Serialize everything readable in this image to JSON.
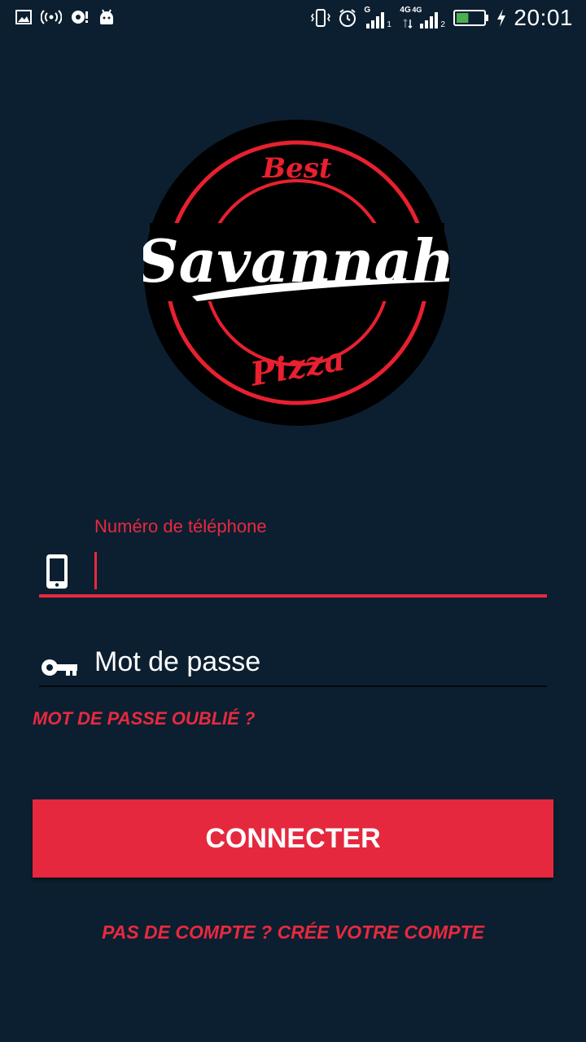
{
  "status_bar": {
    "time": "20:01",
    "sim1_network": "G",
    "sim1_index": "1",
    "sim2_network": "4G",
    "sim2_network_b": "4G",
    "sim2_index": "2",
    "battery_level": 0.45,
    "icons": [
      "image-icon",
      "hotspot-icon",
      "sync-icon",
      "android-icon",
      "vibrate-icon",
      "alarm-icon",
      "signal-icon",
      "battery-icon",
      "charging-icon"
    ]
  },
  "logo": {
    "brand": "Savannah",
    "top_text": "Best",
    "bottom_text": "Pizza"
  },
  "form": {
    "phone_label": "Numéro de téléphone",
    "phone_value": "",
    "password_placeholder": "Mot de passe",
    "forgot_password": "MOT DE PASSE OUBLIÉ ?",
    "connect_button": "CONNECTER",
    "signup_link": "PAS DE COMPTE ? CRÉE VOTRE COMPTE"
  },
  "colors": {
    "background": "#0c1f30",
    "accent": "#e8293f",
    "button": "#e5283e"
  }
}
